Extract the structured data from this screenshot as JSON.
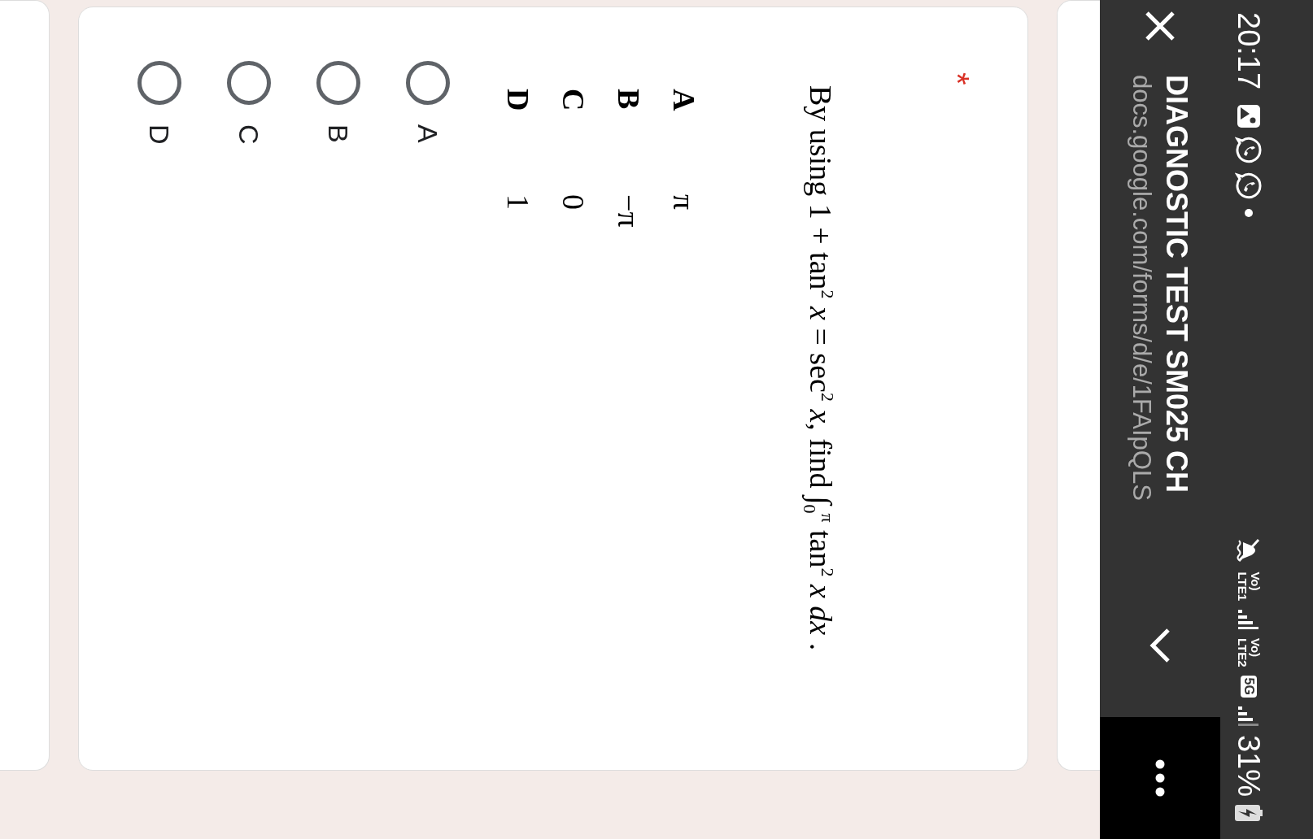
{
  "status_bar": {
    "time": "20:17",
    "sim1": {
      "voice": "Vo)",
      "network": "LTE1"
    },
    "sim2": {
      "voice": "Vo)",
      "network": "LTE2"
    },
    "data_badge": "5G",
    "battery": "31%"
  },
  "header": {
    "title": "DIAGNOSTIC TEST SM025 CH",
    "url": "docs.google.com/forms/d/e/1FAIpQLS"
  },
  "question": {
    "required_mark": "*",
    "text": "By using 1 + tan$^{2}$ *x* = sec$^{2}$ *x*, find ∫$_{0}$$^{π}$ tan$^{2}$ *x* *dx* .",
    "printed_choices": [
      {
        "letter": "A",
        "value": "π"
      },
      {
        "letter": "B",
        "value": "−π"
      },
      {
        "letter": "C",
        "value": "0"
      },
      {
        "letter": "D",
        "value": "1"
      }
    ],
    "options": [
      {
        "label": "A",
        "selected": false
      },
      {
        "label": "B",
        "selected": false
      },
      {
        "label": "C",
        "selected": false
      },
      {
        "label": "D",
        "selected": false
      }
    ]
  }
}
